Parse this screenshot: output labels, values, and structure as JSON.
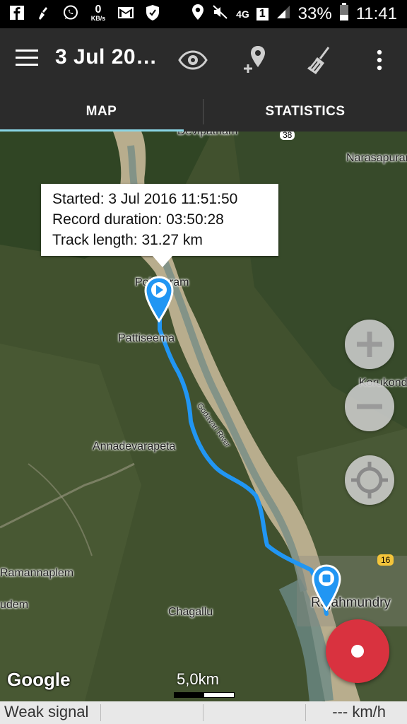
{
  "status_bar": {
    "data_speed_value": "0",
    "data_speed_unit": "KB/s",
    "network_type": "4G",
    "sim_slot": "1",
    "battery": "33%",
    "time": "11:41"
  },
  "toolbar": {
    "title": "3 Jul 20…",
    "icons": [
      "menu-icon",
      "eye-icon",
      "add-location-icon",
      "broom-icon",
      "more-vert-icon"
    ]
  },
  "tabs": [
    {
      "label": "MAP",
      "selected": true
    },
    {
      "label": "STATISTICS",
      "selected": false
    }
  ],
  "map": {
    "places": {
      "devipatnam": "Devipatnam",
      "road_38": "38",
      "narasapuram": "Narasapuram",
      "polavaram": "Polavaram",
      "pattiseema": "Pattiseema",
      "godavari": "Godavari River",
      "korukonda": "Korukonda",
      "annadevarapeta": "Annadevarapeta",
      "ramannaplem": "Ramannaplem",
      "udem": "udem",
      "chagallu": "Chagallu",
      "rajahmundry": "Rajahmundry",
      "road_16": "16"
    },
    "popup": {
      "started": "Started: 3 Jul 2016 11:51:50",
      "duration": "Record duration: 03:50:28",
      "length": "Track length: 31.27 km"
    },
    "track_color": "#2196f3",
    "google_logo": "Google",
    "scale": "5,0km",
    "record_button_color": "#d9323f"
  },
  "status_line": {
    "signal": "Weak signal",
    "speed": "--- km/h"
  }
}
